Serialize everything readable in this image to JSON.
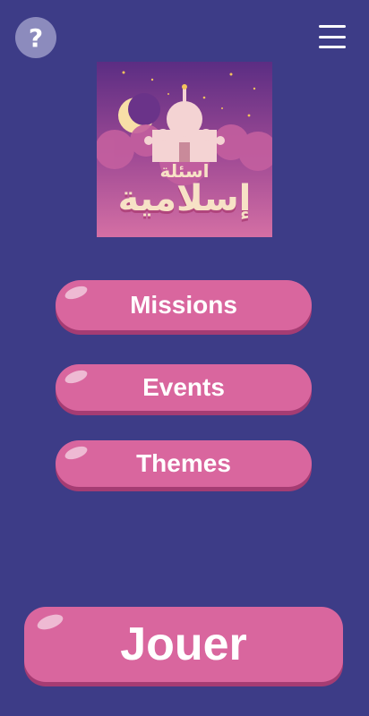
{
  "header": {
    "help_label": "?"
  },
  "logo": {
    "title_top": "اسئلة",
    "title_main": "إسلامية"
  },
  "menu": {
    "missions_label": "Missions",
    "events_label": "Events",
    "themes_label": "Themes"
  },
  "play": {
    "label": "Jouer"
  },
  "colors": {
    "background": "#3d3c87",
    "button": "#d9669e",
    "button_shadow": "#a53c73"
  }
}
